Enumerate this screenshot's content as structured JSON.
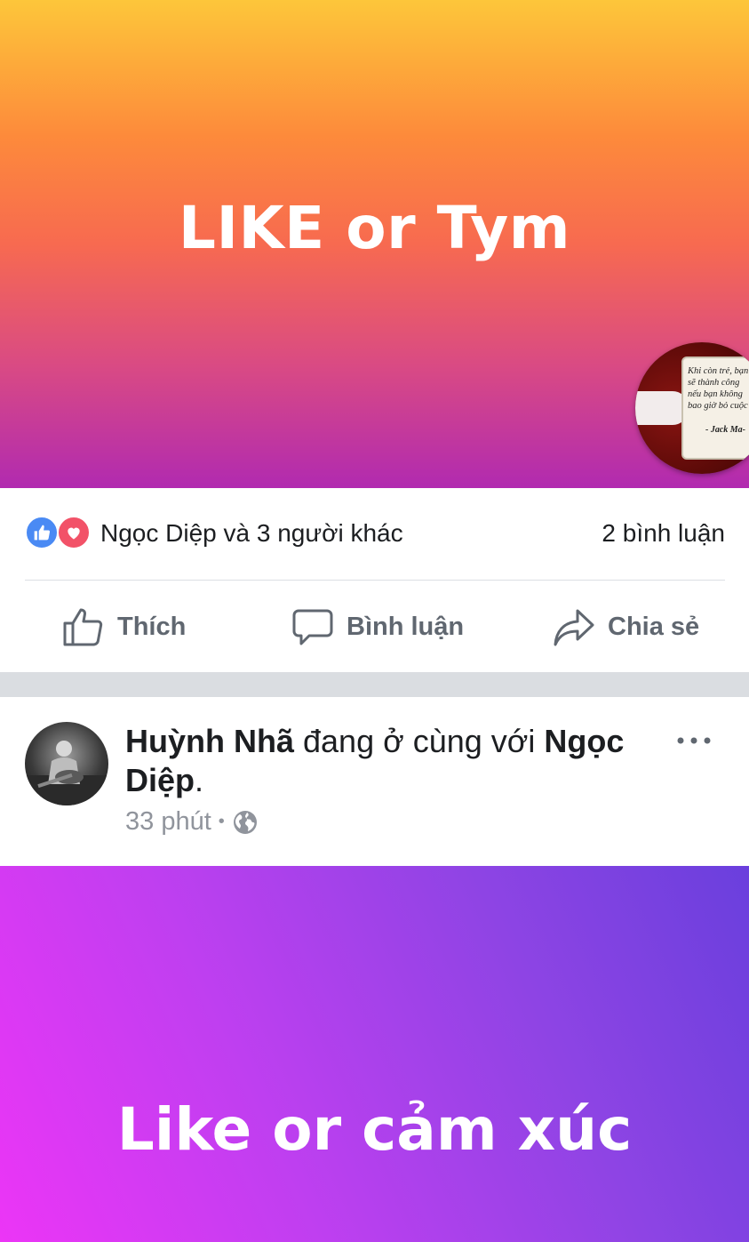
{
  "post1": {
    "banner_text": "LIKE or Tym",
    "chat_head_quote_lines": [
      "Khi còn trẻ, bạn",
      "sẽ thành công",
      "nếu bạn không",
      "bao giờ bỏ cuộc"
    ],
    "chat_head_quote_author": "- Jack Ma-",
    "reactors_text": "Ngọc Diệp và 3 người khác",
    "comments_count": "2 bình luận",
    "actions": {
      "like": "Thích",
      "comment": "Bình luận",
      "share": "Chia sẻ"
    }
  },
  "post2": {
    "author": "Huỳnh Nhã",
    "with_text": " đang ở cùng với ",
    "tagged": "Ngọc Diệp",
    "end_punct": ".",
    "time": "33 phút",
    "separator": "•",
    "privacy_icon": "globe-icon",
    "banner_text": "Like or cảm xúc"
  },
  "colors": {
    "like_blue": "#4a8af4",
    "love_red": "#f25268",
    "action_gray": "#606770",
    "meta_gray": "#90949c",
    "separator_gray": "#dadde1"
  }
}
